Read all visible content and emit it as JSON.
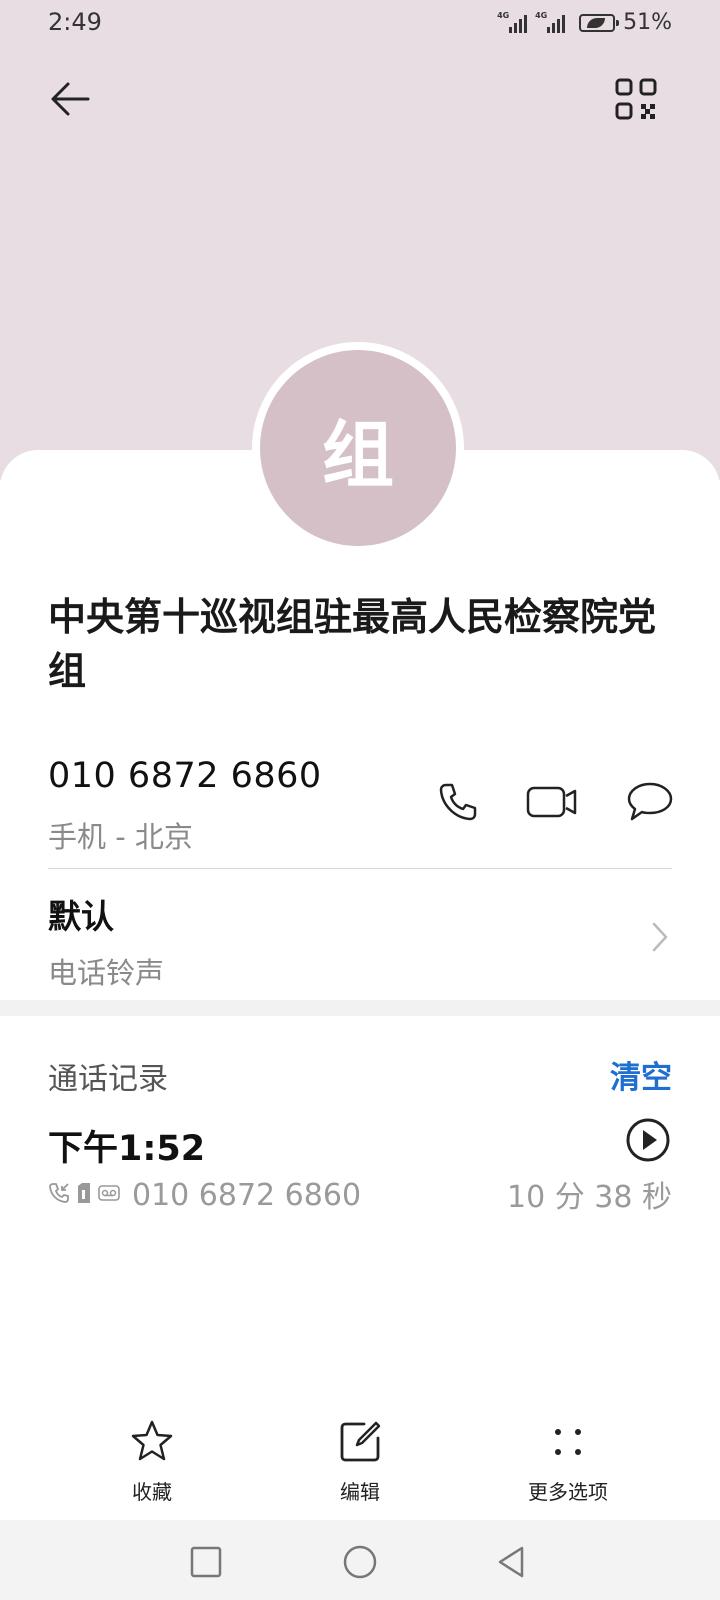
{
  "status_bar": {
    "time": "2:49",
    "network_1": "4G",
    "network_2": "4G",
    "battery": "51%"
  },
  "header": {
    "back_icon": "arrow-left-icon",
    "qr_icon": "qr-code-icon"
  },
  "contact": {
    "avatar_text": "组",
    "avatar_color": "#d5c0c8",
    "name": "中央第十巡视组驻最高人民检察院党组",
    "phone_number": "010 6872 6860",
    "phone_type": "手机 - 北京",
    "actions": [
      "phone-icon",
      "video-call-icon",
      "message-icon"
    ]
  },
  "ringtone": {
    "value": "默认",
    "label": "电话铃声"
  },
  "call_log": {
    "title": "通话记录",
    "clear_label": "清空",
    "entries": [
      {
        "time": "下午1:52",
        "number": "010 6872 6860",
        "duration": "10 分 38 秒"
      }
    ]
  },
  "bottom_actions": {
    "favorite_label": "收藏",
    "edit_label": "编辑",
    "more_label": "更多选项"
  },
  "colors": {
    "header_bg": "#e8dde3",
    "accent": "#1f6fd1"
  }
}
